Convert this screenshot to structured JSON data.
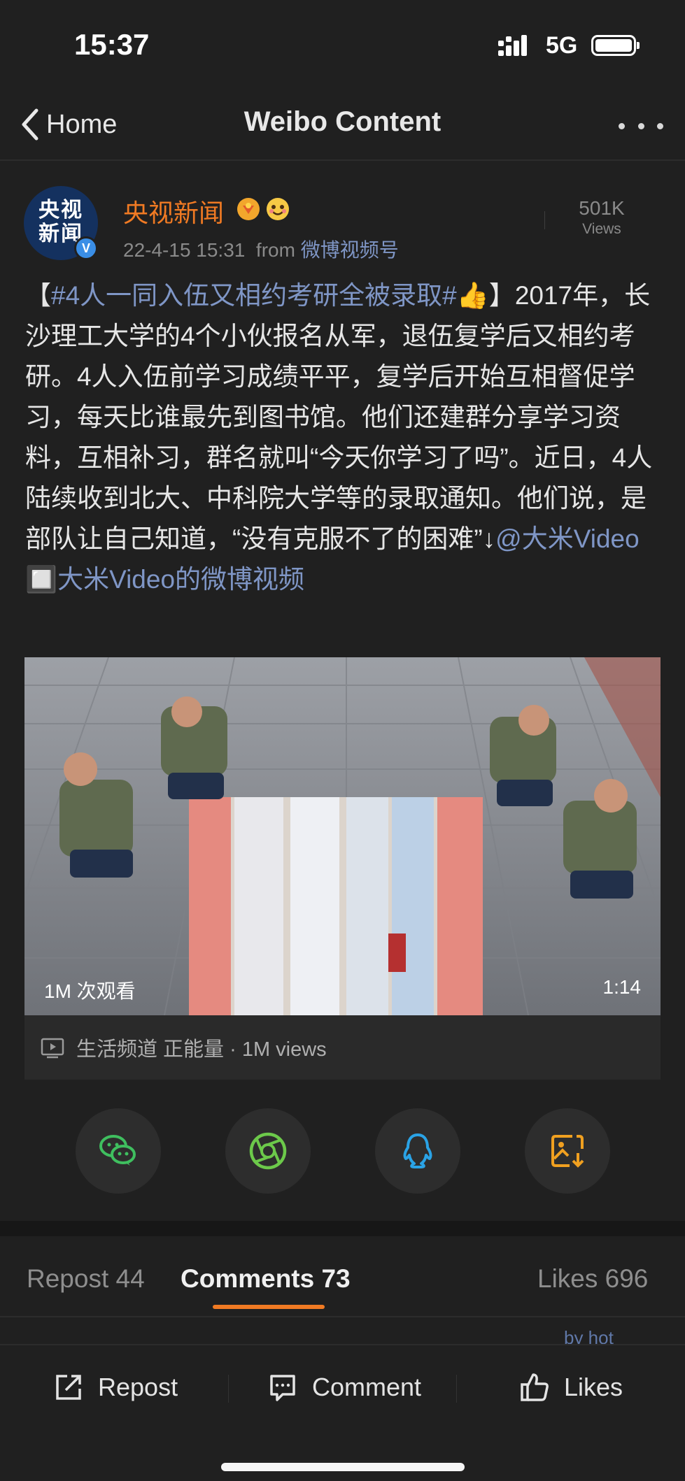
{
  "status_bar": {
    "time": "15:37",
    "network": "5G",
    "icons": [
      "signal-icon",
      "battery-icon"
    ]
  },
  "nav": {
    "back_label": "Home",
    "title": "Weibo Content",
    "icons": [
      "back-chevron-icon",
      "more-icon"
    ]
  },
  "post": {
    "author": "央视新闻",
    "avatar_text": "央视新闻",
    "verified_mark": "V",
    "badges": [
      "medal-icon",
      "emoji-icon"
    ],
    "timestamp": "22-4-15 15:31",
    "from_label": "from",
    "source": "微博视频号",
    "views_count": "501K",
    "views_label": "Views",
    "body": {
      "bracket_open": "【",
      "hashtag": "#4人一同入伍又相约考研全被录取#",
      "emoji": "👍",
      "bracket_close": "】",
      "text": "2017年，长沙理工大学的4个小伙报名从军，退伍复学后又相约考研。4人入伍前学习成绩平平，复学后开始互相督促学习，每天比谁最先到图书馆。他们还建群分享学习资料，互相补习，群名就叫“今天你学习了吗”。近日，4人陆续收到北大、中科院大学等的录取通知。他们说，是部队让自己知道，“没有克服不了的困难”↓",
      "mention": "@大米Video",
      "video_link": "🔲大米Video的微博视频"
    }
  },
  "media": {
    "views_overlay": "1M 次观看",
    "duration": "1:14",
    "channel": "生活频道 正能量 · 1M views"
  },
  "share_buttons": [
    "wechat-icon",
    "moments-icon",
    "qq-icon",
    "save-image-icon"
  ],
  "tabs": {
    "repost": "Repost 44",
    "comments": "Comments 73",
    "likes": "Likes 696",
    "active": "comments"
  },
  "sort_hint": "by hot",
  "actions": {
    "repost": "Repost",
    "comment": "Comment",
    "likes": "Likes"
  },
  "colors": {
    "background": "#202020",
    "accent": "#f07a23",
    "link": "#7f96c6",
    "wechat": "#3fbf5f",
    "moments": "#6cc94a",
    "qq": "#2aa3e6",
    "save": "#f0a020"
  }
}
